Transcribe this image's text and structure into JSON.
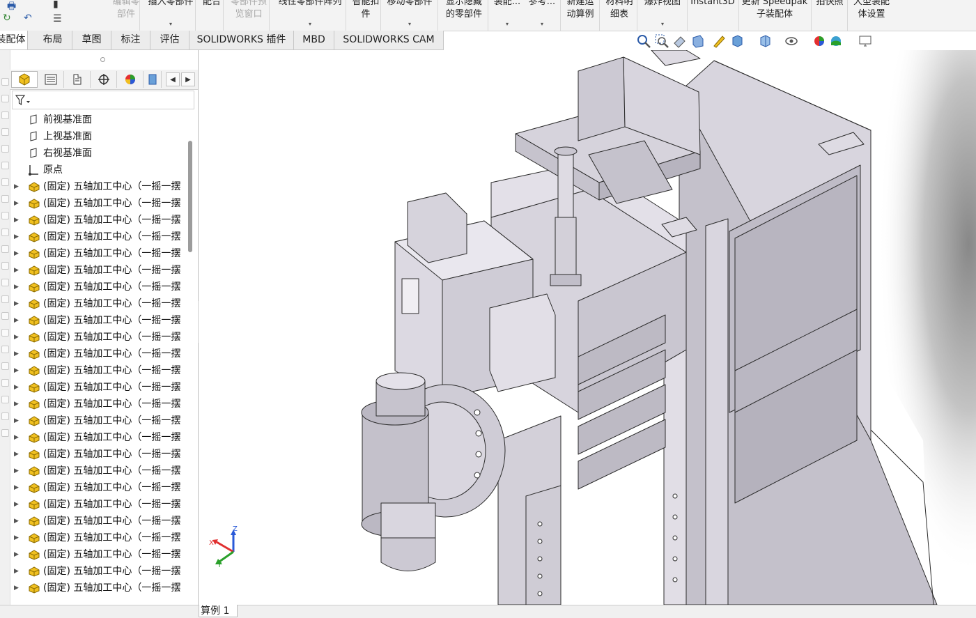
{
  "ribbon": {
    "items": [
      {
        "lines": [
          "编辑零",
          "部件"
        ],
        "disabled": true,
        "arrow": false
      },
      {
        "lines": [
          "插入零部件",
          ""
        ],
        "disabled": false,
        "arrow": true
      },
      {
        "lines": [
          "配合",
          ""
        ],
        "disabled": false,
        "arrow": false
      },
      {
        "lines": [
          "零部件预",
          "览窗口"
        ],
        "disabled": true,
        "arrow": false
      },
      {
        "lines": [
          "线性零部件阵列",
          ""
        ],
        "disabled": false,
        "arrow": true
      },
      {
        "lines": [
          "智能扣",
          "件"
        ],
        "disabled": false,
        "arrow": false
      },
      {
        "lines": [
          "移动零部件",
          ""
        ],
        "disabled": false,
        "arrow": true
      },
      {
        "lines": [
          "显示隐藏",
          "的零部件"
        ],
        "disabled": false,
        "arrow": false
      },
      {
        "lines": [
          "装配...",
          ""
        ],
        "disabled": false,
        "arrow": true
      },
      {
        "lines": [
          "参考...",
          ""
        ],
        "disabled": false,
        "arrow": true
      },
      {
        "lines": [
          "新建运",
          "动算例"
        ],
        "disabled": false,
        "arrow": false
      },
      {
        "lines": [
          "材料明",
          "细表"
        ],
        "disabled": false,
        "arrow": false
      },
      {
        "lines": [
          "爆炸视图",
          ""
        ],
        "disabled": false,
        "arrow": true
      },
      {
        "lines": [
          "Instant3D",
          ""
        ],
        "disabled": false,
        "arrow": false
      },
      {
        "lines": [
          "更新 Speedpak",
          "子装配体"
        ],
        "disabled": false,
        "arrow": false
      },
      {
        "lines": [
          "拍快照",
          ""
        ],
        "disabled": false,
        "arrow": false
      },
      {
        "lines": [
          "大型装配",
          "体设置"
        ],
        "disabled": false,
        "arrow": false
      }
    ]
  },
  "tabs": [
    {
      "label": "装配体",
      "active": true
    },
    {
      "label": "布局",
      "active": false
    },
    {
      "label": "草图",
      "active": false
    },
    {
      "label": "标注",
      "active": false
    },
    {
      "label": "评估",
      "active": false
    },
    {
      "label": "SOLIDWORKS 插件",
      "active": false
    },
    {
      "label": "MBD",
      "active": false
    },
    {
      "label": "SOLIDWORKS CAM",
      "active": false
    }
  ],
  "tree": {
    "planes": [
      {
        "label": "前视基准面",
        "icon": "plane-icon"
      },
      {
        "label": "上视基准面",
        "icon": "plane-icon"
      },
      {
        "label": "右视基准面",
        "icon": "plane-icon"
      },
      {
        "label": "原点",
        "icon": "origin-icon"
      }
    ],
    "component_label": "(固定) 五轴加工中心（一摇一摆",
    "component_count": 25
  },
  "bottom": {
    "tab_label": "算例 1"
  },
  "triad": {
    "x": "X",
    "y": "Y",
    "z": "Z"
  },
  "colors": {
    "part": "#d6d3dc",
    "part_dark": "#b3afbd",
    "edge": "#2b2b2b",
    "accent": "#2a5aa8"
  }
}
